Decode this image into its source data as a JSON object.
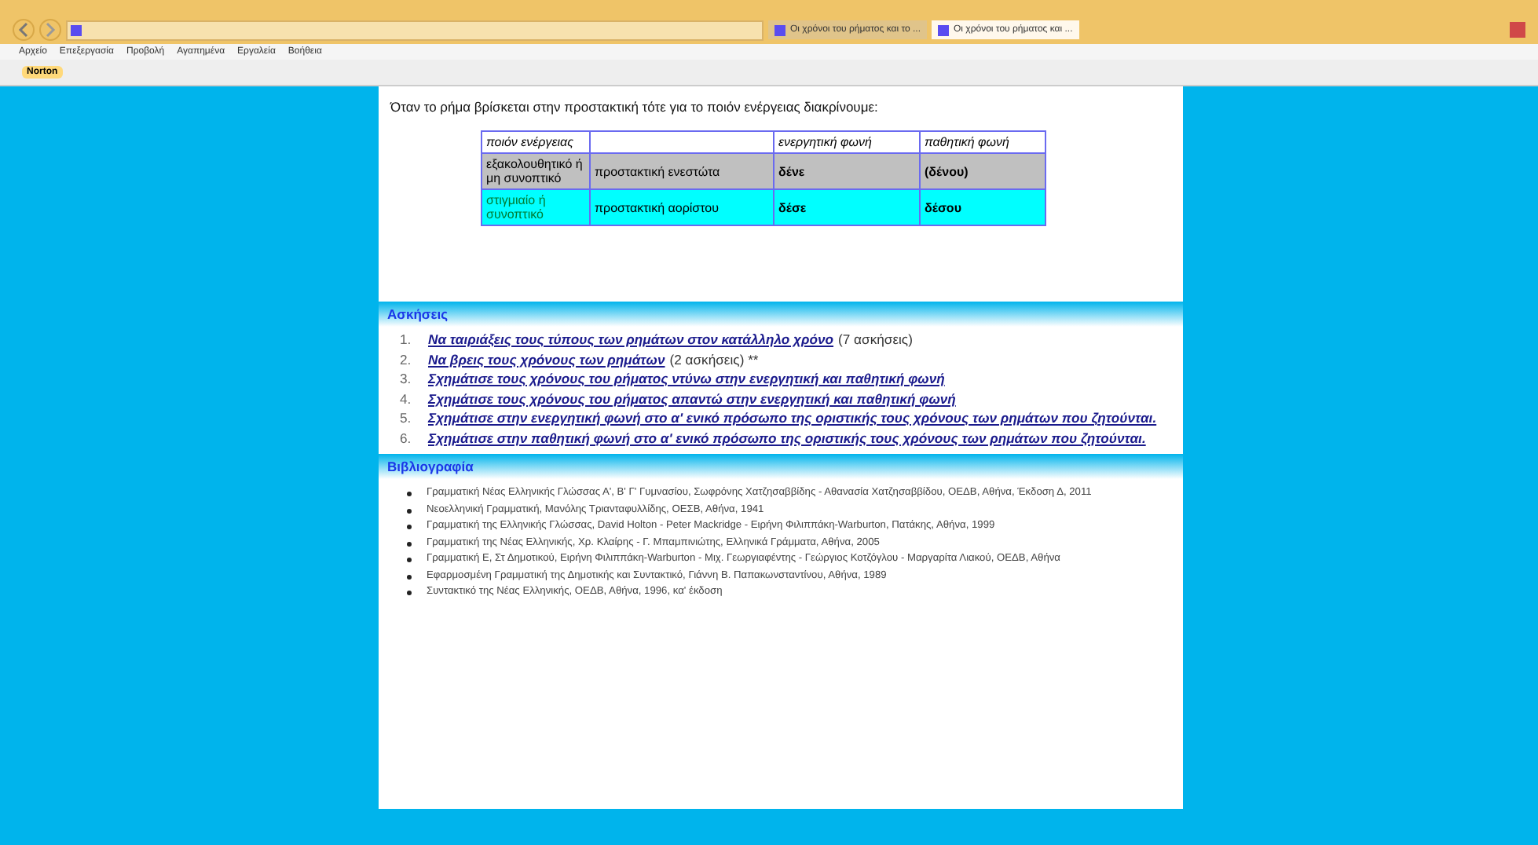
{
  "browser": {
    "tabs": [
      {
        "label": "Οι χρόνοι του ρήματος και το ...",
        "selected": false
      },
      {
        "label": "Οι χρόνοι του ρήματος και ...",
        "selected": true
      }
    ],
    "menu": [
      "Αρχείο",
      "Επεξεργασία",
      "Προβολή",
      "Αγαπημένα",
      "Εργαλεία",
      "Βοήθεια"
    ],
    "favorites": [
      "Norton"
    ]
  },
  "intro": "Όταν το ρήμα βρίσκεται στην προστακτική τότε για το ποιόν ενέργειας διακρίνουμε:",
  "table": {
    "columns": [
      "ποιόν ενέργειας",
      "",
      "ενεργητική φωνή",
      "παθητική φωνή"
    ],
    "rows": [
      {
        "color": "#c0c0c0",
        "cells": [
          "εξακολουθητικό ή μη συνοπτικό",
          "προστακτική ενεστώτα",
          "δένε",
          "(δένου)"
        ]
      },
      {
        "color": "#00ffff",
        "cells": [
          "στιγμιαίο ή συνοπτικό",
          "προστακτική αορίστου",
          "δέσε",
          "δέσου"
        ]
      }
    ]
  },
  "exercises": {
    "title": "Ασκήσεις",
    "items": [
      {
        "number": "1.",
        "link": "Να ταιριάξεις τους τύπους των ρημάτων στον κατάλληλο χρόνο",
        "note": "(7 ασκήσεις)"
      },
      {
        "number": "2.",
        "link": "Να βρεις τους χρόνους των ρημάτων",
        "note": "(2 ασκήσεις) **"
      },
      {
        "number": "3.",
        "link": "Σχημάτισε τους χρόνους του ρήματος ντύνω στην ενεργητική και παθητική φωνή"
      },
      {
        "number": "4.",
        "link": "Σχημάτισε τους χρόνους του ρήματος απαντώ στην ενεργητική και παθητική φωνή"
      },
      {
        "number": "5.",
        "link": "Σχημάτισε στην ενεργητική φωνή στο α' ενικό πρόσωπο της οριστικής τους χρόνους των ρημάτων που ζητούνται."
      },
      {
        "number": "6.",
        "link": "Σχημάτισε στην παθητική φωνή στο α' ενικό πρόσωπο της οριστικής τους χρόνους των ρημάτων που ζητούνται."
      }
    ]
  },
  "bibliography": {
    "title": "Βιβλιογραφία",
    "items": [
      "Γραμματική Νέας Ελληνικής Γλώσσας Α', Β' Γ' Γυμνασίου, Σωφρόνης Χατζησαββίδης - Αθανασία Χατζησαββίδου, ΟΕΔΒ, Αθήνα, Έκδοση Δ, 2011",
      "Νεοελληνική Γραμματική, Μανόλης Τριανταφυλλίδης, ΟΕΣΒ, Αθήνα, 1941",
      "Γραμματική της Ελληνικής Γλώσσας, David Holton - Peter Mackridge - Ειρήνη Φιλιππάκη-Warburton, Πατάκης, Αθήνα, 1999",
      "Γραμματική της Νέας Ελληνικής, Χρ. Κλαίρης - Γ. Μπαμπινιώτης, Ελληνικά Γράμματα, Αθήνα, 2005",
      "Γραμματική Ε, Στ Δημοτικού, Ειρήνη Φιλιππάκη-Warburton - Μιχ. Γεωργιαφέντης - Γεώργιος Κοτζόγλου - Μαργαρίτα Λιακού, ΟΕΔΒ, Αθήνα",
      "Εφαρμοσμένη Γραμματική της Δημοτικής και Συντακτικό, Γιάννη Β. Παπακωνσταντίνου, Αθήνα, 1989",
      "Συντακτικό της Νέας Ελληνικής, ΟΕΔΒ, Αθήνα, 1996, κα' έκδοση"
    ]
  }
}
